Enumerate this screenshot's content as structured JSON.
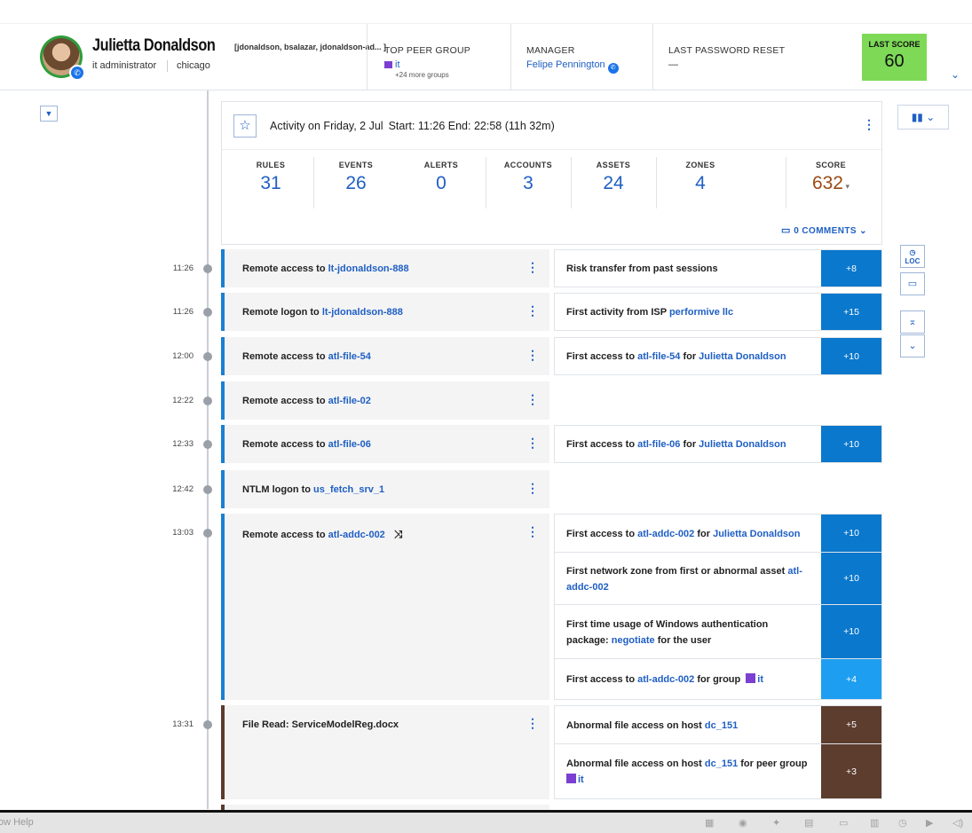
{
  "header": {
    "user_name": "Julietta Donaldson",
    "accounts": "[jdonaldson, bsalazar, jdonaldson-ad... ]",
    "role": "it administrator",
    "location": "chicago",
    "peer_group_title": "TOP PEER GROUP",
    "peer_group_value": "it",
    "peer_group_more": "+24 more groups",
    "manager_title": "MANAGER",
    "manager_value": "Felipe Pennington",
    "password_title": "LAST PASSWORD RESET",
    "password_value": "—",
    "last_score_label": "LAST SCORE",
    "last_score_value": "60",
    "last_score_color": "#7ed957"
  },
  "activity": {
    "title": "Activity on Friday, 2 Jul",
    "times": "Start: 11:26 End: 22:58 (11h 32m)",
    "stats": [
      {
        "label": "RULES",
        "value": "31"
      },
      {
        "label": "EVENTS",
        "value": "26"
      },
      {
        "label": "ALERTS",
        "value": "0"
      },
      {
        "label": "ACCOUNTS",
        "value": "3"
      },
      {
        "label": "ASSETS",
        "value": "24"
      },
      {
        "label": "ZONES",
        "value": "4"
      },
      {
        "label": "SCORE",
        "value": "632"
      }
    ],
    "comments": "0 COMMENTS"
  },
  "timeline": [
    {
      "time": "11:26",
      "event_pre": "Remote access to ",
      "event_link": "lt-jdonaldson-888"
    },
    {
      "time": "11:26",
      "event_pre": "Remote logon to ",
      "event_link": "lt-jdonaldson-888"
    },
    {
      "time": "12:00",
      "event_pre": "Remote access to ",
      "event_link": "atl-file-54"
    },
    {
      "time": "12:22",
      "event_pre": "Remote access to ",
      "event_link": "atl-file-02"
    },
    {
      "time": "12:33",
      "event_pre": "Remote access to ",
      "event_link": "atl-file-06"
    },
    {
      "time": "12:42",
      "event_pre": "NTLM logon to ",
      "event_link": "us_fetch_srv_1"
    },
    {
      "time": "13:03",
      "event_pre": "Remote access to ",
      "event_link": "atl-addc-002"
    },
    {
      "time": "13:31",
      "event_pre": "File Read: ServiceModelReg.docx",
      "event_link": ""
    }
  ],
  "reasons": {
    "r1": {
      "text": "Risk transfer from past sessions",
      "score": "+8"
    },
    "r2": {
      "pre": "First activity from ISP ",
      "link": "performive llc",
      "score": "+15"
    },
    "r3": {
      "pre": "First access to ",
      "link": "atl-file-54",
      "mid": " for ",
      "link2": "Julietta Donaldson",
      "score": "+10"
    },
    "r4": {
      "pre": "First access to ",
      "link": "atl-file-06",
      "mid": " for ",
      "link2": "Julietta Donaldson",
      "score": "+10"
    },
    "r5": {
      "pre": "First access to ",
      "link": "atl-addc-002",
      "mid": " for ",
      "link2": "Julietta Donaldson",
      "score": "+10"
    },
    "r6": {
      "pre": "First network zone from first or abnormal asset ",
      "link": "atl-addc-002",
      "score": "+10"
    },
    "r7": {
      "pre": "First time usage of Windows authentication package: ",
      "link": "negotiate",
      "post": " for the user",
      "score": "+10"
    },
    "r8": {
      "pre": "First access to ",
      "link": "atl-addc-002",
      "mid": " for group ",
      "link2": "it",
      "score": "+4"
    },
    "r9": {
      "pre": "Abnormal file access on host ",
      "link": "dc_151",
      "score": "+5"
    },
    "r10": {
      "pre": "Abnormal file access on host ",
      "link": "dc_151",
      "mid": " for peer group",
      "link2": "it",
      "score": "+3"
    }
  },
  "side_tools": {
    "loc_label": "LOC"
  },
  "footer": {
    "menu": "ow    Help"
  },
  "colors": {
    "accent": "#1f5fc4",
    "score_blue": "#0a78cc",
    "score_light_blue": "#1e9ef0",
    "score_brown": "#5c3d2e",
    "event_border_blue": "#1a7fd1"
  }
}
